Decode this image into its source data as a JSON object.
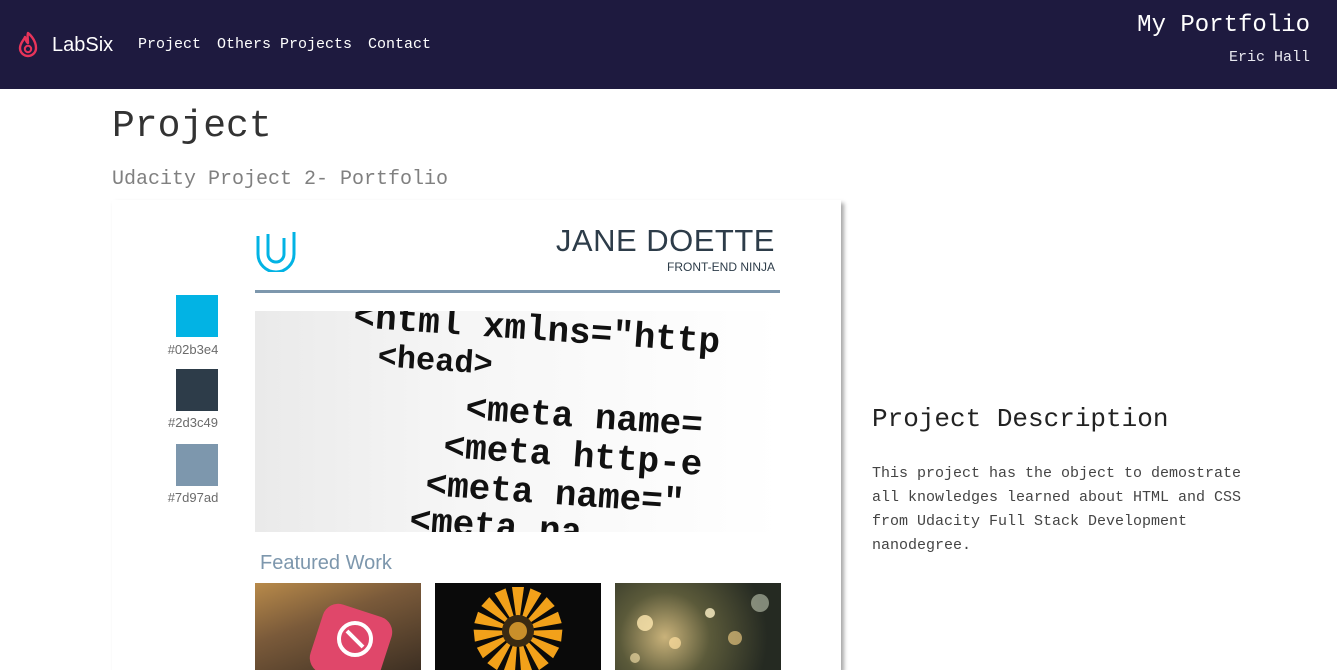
{
  "header": {
    "brand": "LabSix",
    "nav": [
      "Project",
      "Others Projects",
      "Contact"
    ],
    "site_title": "My Portfolio",
    "author": "Eric Hall",
    "background_color": "#1e1a3f"
  },
  "page": {
    "title": "Project",
    "subtitle": "Udacity Project 2- Portfolio"
  },
  "project_image": {
    "swatches": [
      {
        "color": "#02b3e4",
        "label": "#02b3e4"
      },
      {
        "color": "#2d3c49",
        "label": "#2d3c49"
      },
      {
        "color": "#7d97ad",
        "label": "#7d97ad"
      }
    ],
    "mock_name": "JANE DOETTE",
    "mock_role": "FRONT-END NINJA",
    "code_lines": [
      "<html xmlns=\"http",
      "<head>",
      "<meta name=",
      "<meta http-e",
      "<meta name=\"",
      "<meta na"
    ],
    "featured_heading": "Featured Work",
    "thumbnails": [
      "app-icon-thumbnail",
      "flower-thumbnail",
      "bokeh-lights-thumbnail"
    ]
  },
  "description": {
    "title": "Project Description",
    "body": "This project has the object to demostrate all knowledges learned about HTML and CSS from Udacity Full Stack Development nanodegree."
  }
}
